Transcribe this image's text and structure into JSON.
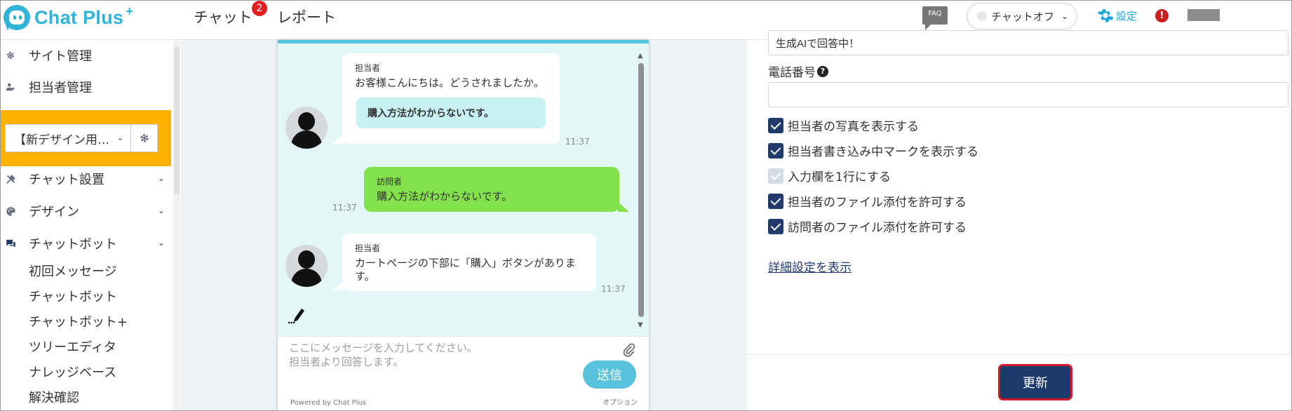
{
  "app": {
    "logo_text": "Chat Plus",
    "logo_plus": "+"
  },
  "header": {
    "nav": [
      {
        "label": "チャット",
        "badge": "2"
      },
      {
        "label": "レポート"
      }
    ],
    "faq_label": "FAQ",
    "status_select": {
      "value": "チャットオフ"
    },
    "settings_label": "設定",
    "alert_symbol": "!"
  },
  "sidebar": {
    "items": [
      {
        "label": "サイト管理",
        "icon": "gear-icon"
      },
      {
        "label": "担当者管理",
        "icon": "users-icon"
      }
    ],
    "site_select": {
      "value": "【新デザイン用…"
    },
    "groups": [
      {
        "label": "チャット設置",
        "icon": "tools-icon"
      },
      {
        "label": "デザイン",
        "icon": "palette-icon"
      },
      {
        "label": "チャットボット",
        "icon": "chat-bubbles-icon"
      }
    ],
    "subitems": [
      "初回メッセージ",
      "チャットボット",
      "チャットボット+",
      "ツリーエディタ",
      "ナレッジベース",
      "解決確認"
    ]
  },
  "preview": {
    "messages": [
      {
        "sender": "担当者",
        "text": "お客様こんにちは。どうされましたか。",
        "choice": "購入方法がわからないです。",
        "time": "11:37"
      },
      {
        "sender": "訪問者",
        "text": "購入方法がわからないです。",
        "time": "11:37"
      },
      {
        "sender": "担当者",
        "text": "カートページの下部に「購入」ボタンがあります。",
        "time": "11:37"
      }
    ],
    "input_placeholder_line1": "ここにメッセージを入力してください。",
    "input_placeholder_line2": "担当者より回答します。",
    "send_label": "送信",
    "powered_by": "Powered by Chat Plus",
    "option_label": "オプション"
  },
  "panel": {
    "top_input_value": "生成AIで回答中！",
    "phone_label": "電話番号",
    "phone_value": "",
    "checkboxes": [
      {
        "label": "担当者の写真を表示する",
        "checked": true,
        "disabled": false
      },
      {
        "label": "担当者書き込み中マークを表示する",
        "checked": true,
        "disabled": false
      },
      {
        "label": "入力欄を1行にする",
        "checked": true,
        "disabled": true
      },
      {
        "label": "担当者のファイル添付を許可する",
        "checked": true,
        "disabled": false
      },
      {
        "label": "訪問者のファイル添付を許可する",
        "checked": true,
        "disabled": false
      }
    ],
    "advanced_link": "詳細設定を表示",
    "update_label": "更新"
  },
  "colors": {
    "brand": "#2fb3d8",
    "sidebar_highlight": "#ffb300",
    "visitor_bubble": "#83e14b",
    "primary_button": "#1d3a6c",
    "button_outline": "#d11b2a"
  }
}
